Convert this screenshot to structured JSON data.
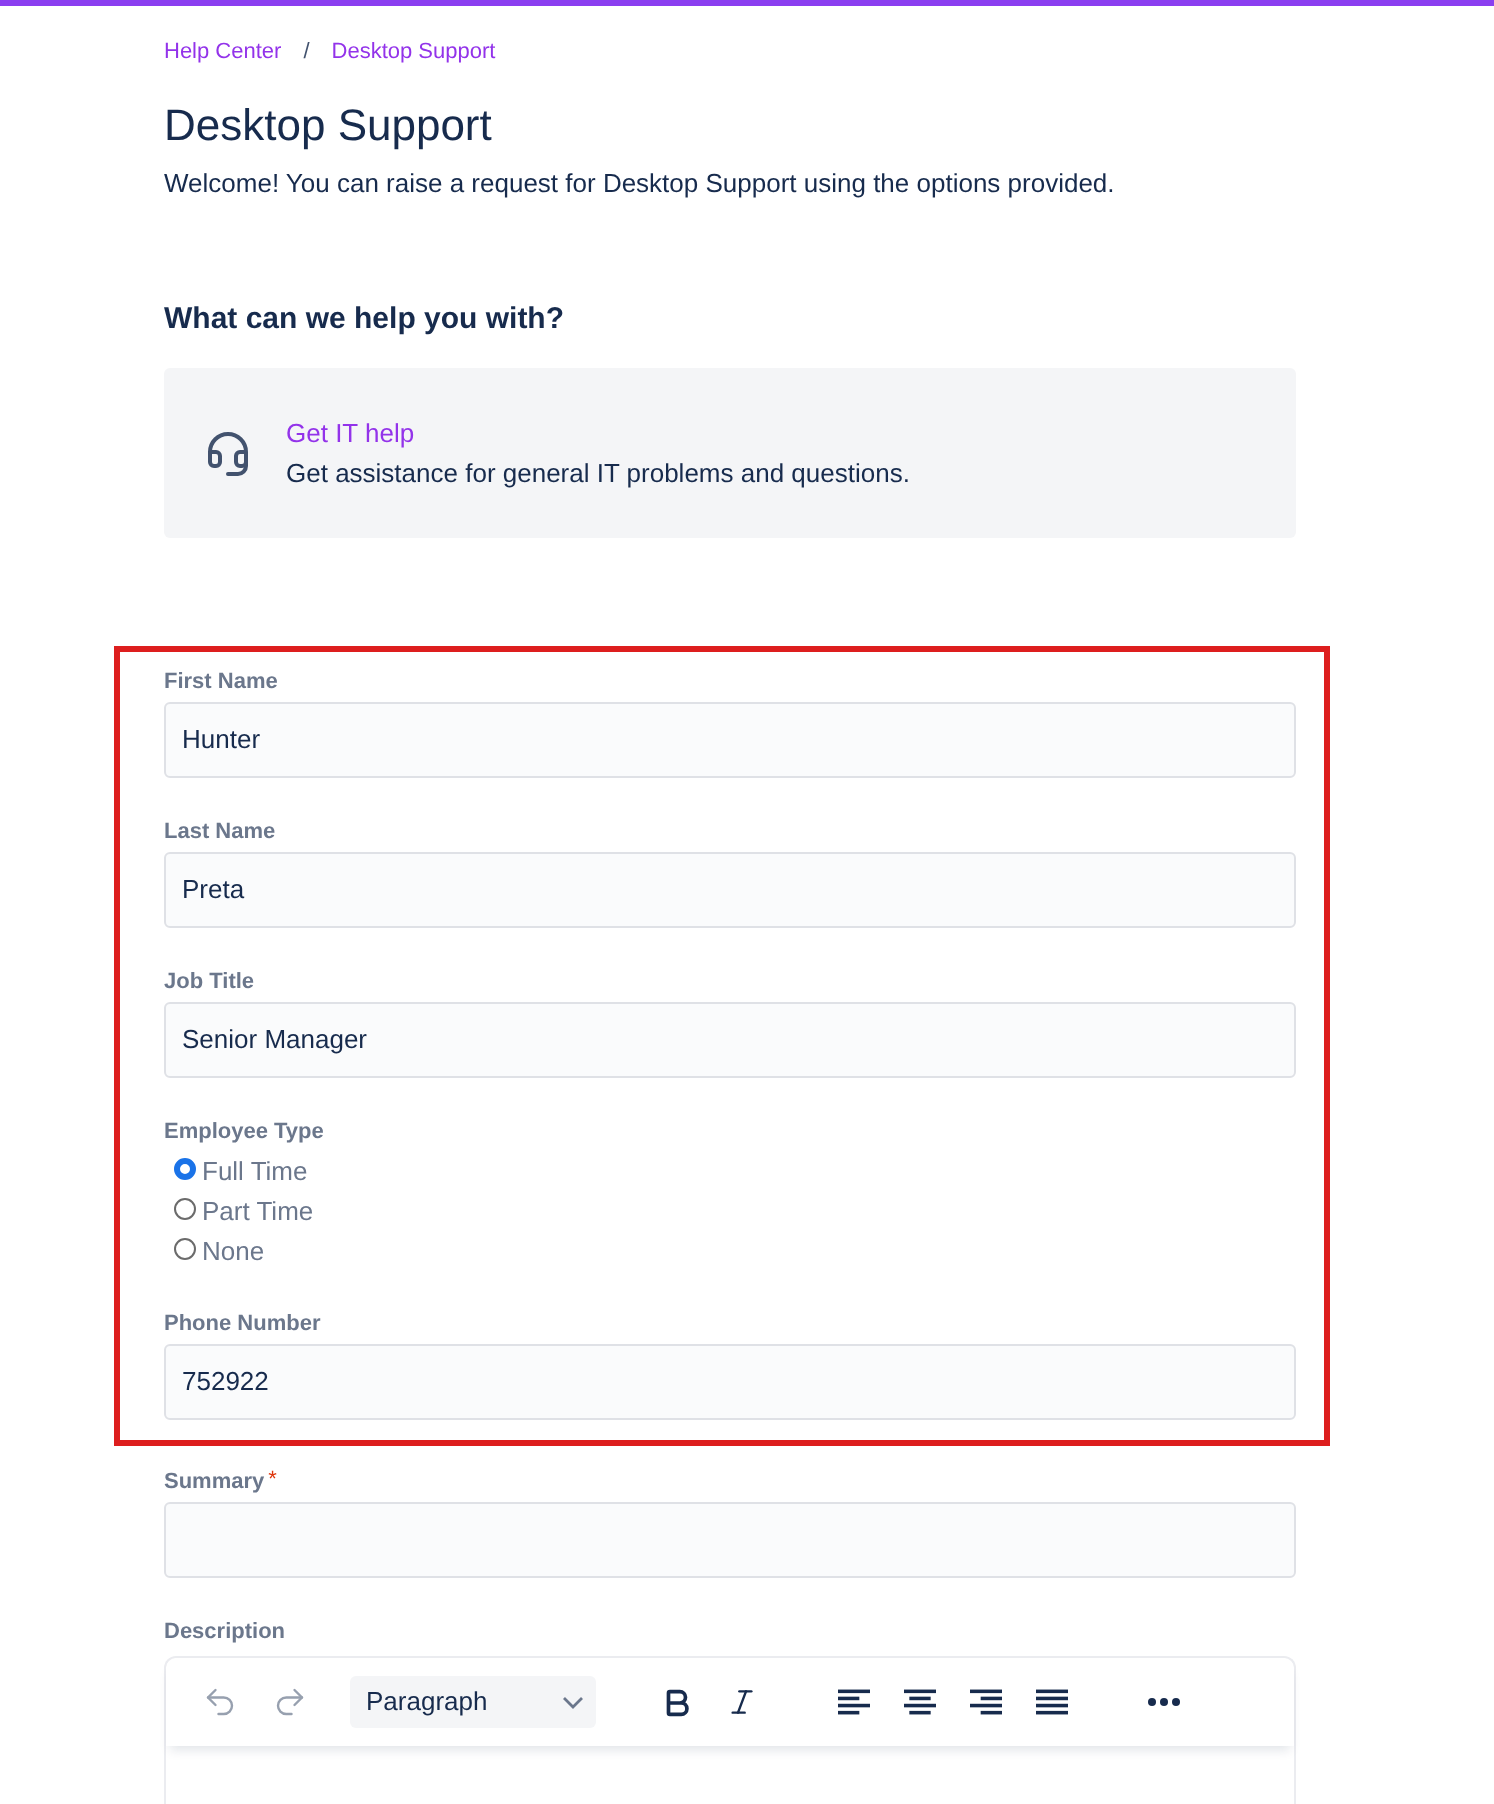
{
  "breadcrumbs": {
    "separator": "/",
    "items": [
      {
        "label": "Help Center"
      },
      {
        "label": "Desktop Support"
      }
    ]
  },
  "header": {
    "title": "Desktop Support",
    "description": "Welcome! You can raise a request for Desktop Support using the options provided."
  },
  "request_types": {
    "heading": "What can we help you with?",
    "items": [
      {
        "title": "Get IT help",
        "description": "Get assistance for general IT problems and questions."
      }
    ]
  },
  "form": {
    "highlighted_fields": [
      {
        "kind": "text",
        "label": "First Name",
        "required": false,
        "value": "Hunter"
      },
      {
        "kind": "text",
        "label": "Last Name",
        "required": false,
        "value": "Preta"
      },
      {
        "kind": "text",
        "label": "Job Title",
        "required": false,
        "value": "Senior Manager"
      },
      {
        "kind": "radio",
        "label": "Employee Type",
        "required": false,
        "options": [
          {
            "label": "Full Time",
            "selected": true
          },
          {
            "label": "Part Time",
            "selected": false
          },
          {
            "label": "None",
            "selected": false
          }
        ]
      },
      {
        "kind": "text",
        "label": "Phone Number",
        "required": false,
        "value": "752922"
      }
    ],
    "fields": [
      {
        "kind": "text",
        "label": "Summary",
        "required": true,
        "required_mark": "*"
      },
      {
        "kind": "editor",
        "label": "Description",
        "required": false,
        "block_style": "Paragraph"
      }
    ]
  }
}
